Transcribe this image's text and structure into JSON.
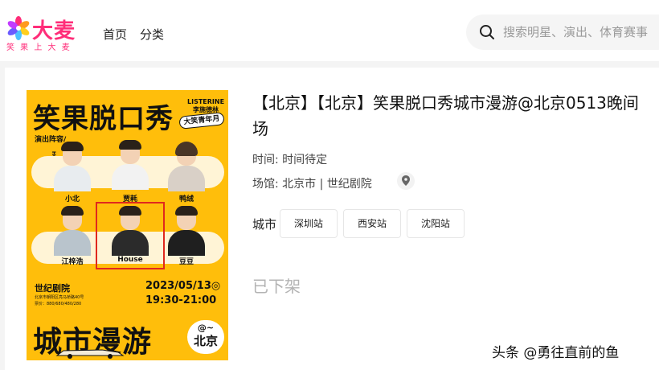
{
  "header": {
    "logo_text": "大麦",
    "logo_slogan": "笑 果 上 大 麦",
    "nav": {
      "home": "首页",
      "category": "分类"
    },
    "search": {
      "placeholder": "搜索明星、演出、体育赛事"
    }
  },
  "poster": {
    "title": "笑果脱口秀",
    "brand_line1": "LISTERINE",
    "brand_line2": "李施德林",
    "badge": "大笑青年月",
    "lineup_label": "演出阵容/",
    "host_label": "HOST",
    "performers": [
      "小北",
      "贾耗",
      "鸭绒",
      "江梓浩",
      "House",
      "豆豆"
    ],
    "venue": "世纪剧院",
    "address": "北京市朝阳区亮马桥路40号",
    "price": "票价：880/680/480/280",
    "date": "2023/05/13",
    "date_suffix": "◎",
    "time": "19:30-21:00",
    "big_text": "城市漫游",
    "city_at": "@~",
    "city_name": "北京"
  },
  "detail": {
    "title": "【北京】【北京】笑果脱口秀城市漫游@北京0513晚间场",
    "time_label": "时间: 时间待定",
    "venue_label": "场馆: 北京市 | 世纪剧院",
    "city_label": "城市",
    "cities": [
      "深圳站",
      "西安站",
      "沈阳站"
    ],
    "status": "已下架"
  },
  "watermark": "头条 @勇往直前的鱼",
  "colors": {
    "brand": "#ff2d79",
    "poster_bg": "#ffbe0b",
    "highlight_box": "#e0281e"
  }
}
